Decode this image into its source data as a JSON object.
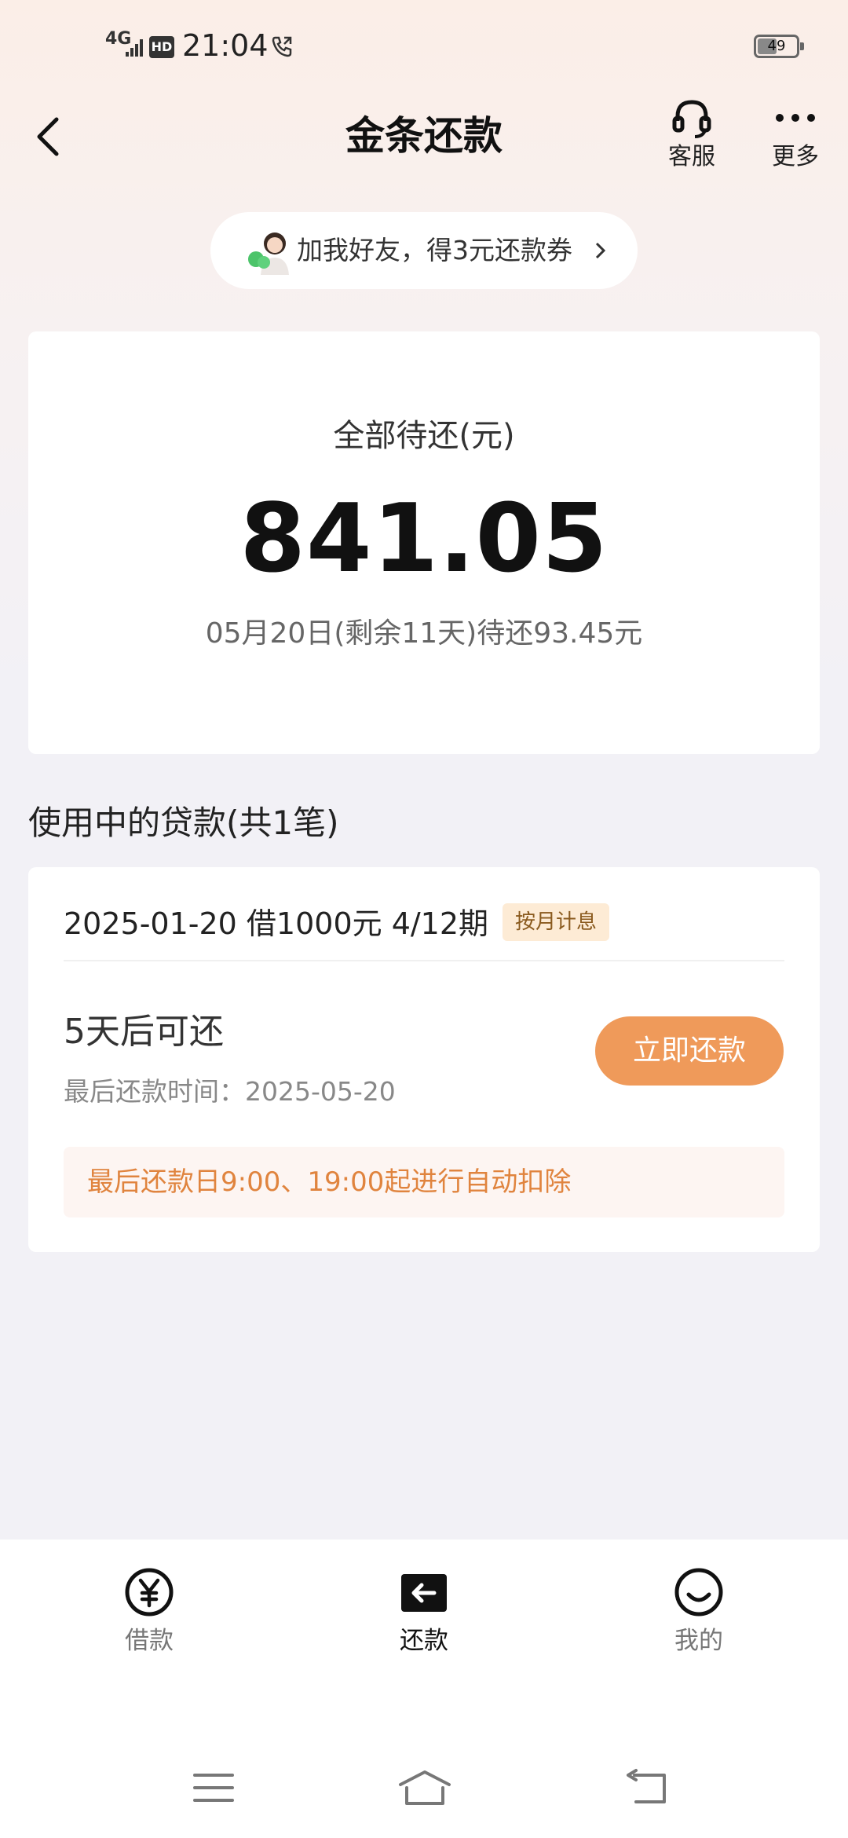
{
  "status_bar": {
    "network": "4G",
    "hd_badge": "HD",
    "time": "21:04",
    "battery": "49",
    "battery_level": 0.49
  },
  "header": {
    "title": "金条还款",
    "service_label": "客服",
    "more_label": "更多"
  },
  "promo": {
    "text": "加我好友，得3元还款券"
  },
  "summary": {
    "label": "全部待还(元)",
    "amount": "841.05",
    "sub": "05月20日(剩余11天)待还93.45元"
  },
  "loans_section": {
    "title": "使用中的贷款(共1笔)"
  },
  "loan": {
    "head": "2025-01-20 借1000元 4/12期",
    "tag": "按月计息",
    "status": "5天后可还",
    "deadline": "最后还款时间：2025-05-20",
    "pay_button": "立即还款",
    "auto_note": "最后还款日9:00、19:00起进行自动扣除"
  },
  "bottom_nav": {
    "items": [
      {
        "label": "借款",
        "icon": "yen-circle-icon",
        "active": false
      },
      {
        "label": "还款",
        "icon": "return-arrow-icon",
        "active": true
      },
      {
        "label": "我的",
        "icon": "smile-icon",
        "active": false
      }
    ]
  },
  "colors": {
    "accent_orange": "#ef9a5a",
    "note_text": "#e0843e",
    "tag_bg": "#fdebd5"
  }
}
